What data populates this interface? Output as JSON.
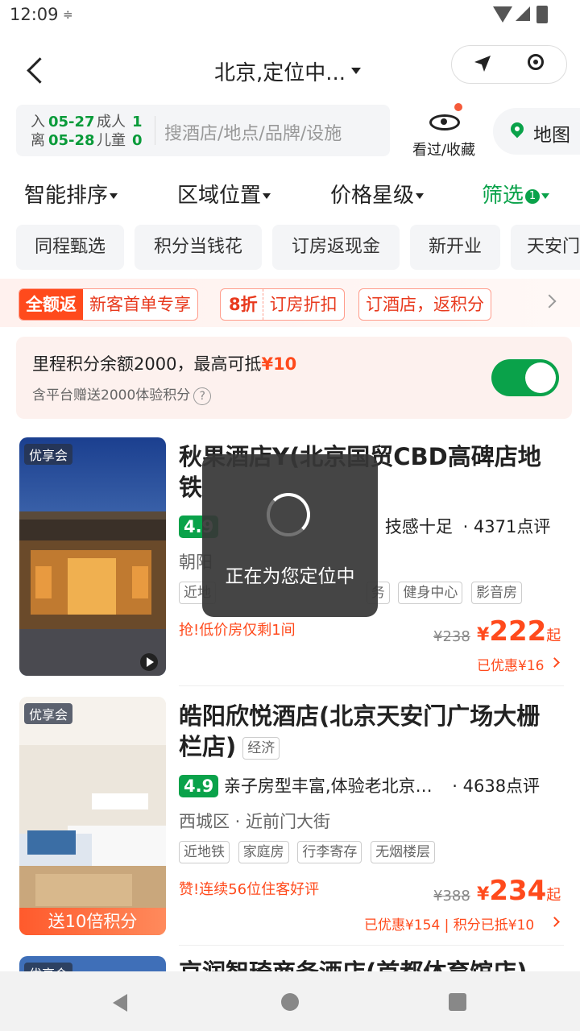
{
  "status": {
    "time": "12:09",
    "bolt": "≑"
  },
  "header": {
    "title": "北京,定位中..."
  },
  "search": {
    "checkin_label": "入",
    "checkin_date": "05-27",
    "adult_label": "成人",
    "adult_count": "1",
    "checkout_label": "离",
    "checkout_date": "05-28",
    "child_label": "儿童",
    "child_count": "0",
    "placeholder": "搜酒店/地点/品牌/设施"
  },
  "fav_label": "看过/收藏",
  "map_label": "地图",
  "sort": {
    "smart": "智能排序",
    "area": "区域位置",
    "price": "价格星级",
    "filter": "筛选",
    "filter_count": "1"
  },
  "chips": [
    "同程甄选",
    "积分当钱花",
    "订房返现金",
    "新开业",
    "天安门"
  ],
  "promo": {
    "tag1_solid": "全额返",
    "tag1_text": "新客首单专享",
    "tag2_bold": "8折",
    "tag2_text": "订房折扣",
    "tag3_text": "订酒店，返积分"
  },
  "points": {
    "line1_prefix": "里程积分余额2000，最高可抵",
    "line1_amount": "¥10",
    "line2": "含平台赠送2000体验积分",
    "question": "?"
  },
  "hotels": [
    {
      "badge": "优享会",
      "name_line1": "秋果酒店Y(北京国贸CBD高碑店地",
      "name_line2": "铁",
      "rating": "4.9",
      "summary": "技感十足",
      "reviews": "· 4371点评",
      "location": "朝阳",
      "tags": [
        "近地",
        "务",
        "健身中心",
        "影音房"
      ],
      "highlight": "抢!低价房仅剩1间",
      "old_price": "¥238",
      "price_cur": "¥",
      "price": "222",
      "price_suffix": "起",
      "saving": "已优惠¥16"
    },
    {
      "badge": "优享会",
      "banner": "送10倍积分",
      "name_line1": "皓阳欣悦酒店(北京天安门广场大栅",
      "name_line2": "栏店)",
      "level": "经济",
      "rating": "4.9",
      "summary": "亲子房型丰富,体验老北京…",
      "reviews": "· 4638点评",
      "location": "西城区 · 近前门大街",
      "tags": [
        "近地铁",
        "家庭房",
        "行李寄存",
        "无烟楼层"
      ],
      "highlight": "赞!连续56位住客好评",
      "old_price": "¥388",
      "price_cur": "¥",
      "price": "234",
      "price_suffix": "起",
      "saving": "已优惠¥154 | 积分已抵¥10"
    },
    {
      "badge": "优享会",
      "name_line1": "京润智琦商务酒店(首都体育馆店)"
    }
  ],
  "toast": {
    "message": "正在为您定位中"
  }
}
